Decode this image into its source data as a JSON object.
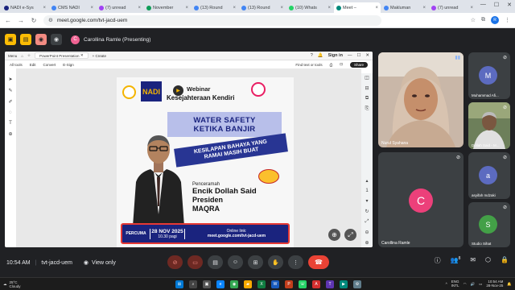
{
  "browser": {
    "tabs": [
      {
        "label": "NADI e-Sys",
        "icon": "nadi-icon",
        "color": "#1a237e"
      },
      {
        "label": "CMS NADI",
        "icon": "cms-icon",
        "color": "#4285f4"
      },
      {
        "label": "(7) unread",
        "icon": "mail-icon",
        "color": "#a142f4"
      },
      {
        "label": "November",
        "icon": "sheet-icon",
        "color": "#0f9d58"
      },
      {
        "label": "(13) Round",
        "icon": "chat-icon",
        "color": "#4285f4"
      },
      {
        "label": "(13) Round",
        "icon": "chat-icon",
        "color": "#4285f4"
      },
      {
        "label": "(10) Whats",
        "icon": "whatsapp-icon",
        "color": "#25d366"
      },
      {
        "label": "Meet –",
        "icon": "meet-icon",
        "color": "#00897b"
      },
      {
        "label": "Makluman",
        "icon": "doc-icon",
        "color": "#4285f4"
      },
      {
        "label": "(7) unread",
        "icon": "mail-icon",
        "color": "#a142f4"
      }
    ],
    "url": "meet.google.com/tvt-jacd-uem"
  },
  "presenting": {
    "name": "Carollina Ramle (Presenting)",
    "avatar_letter": "C"
  },
  "pdf": {
    "tab_title": "PowerPoint Presentation",
    "menu_label": "Menu",
    "create_label": "Create",
    "sign_in": "Sign in",
    "menus": [
      "All tools",
      "Edit",
      "Convert",
      "E-Sign"
    ],
    "search_tools": "Find text or tools",
    "share": "Share"
  },
  "poster": {
    "webinar": "Webinar",
    "subtitle": "Kesejahteraan Kendiri",
    "line1": "WATER SAFETY",
    "line2": "KETIKA BANJIR",
    "line3": "KESILAPAN BAHAYA YANG",
    "line4": "RAMAI MASIH BUAT",
    "penceramah": "Penceramah",
    "speaker": "Encik Dollah Said",
    "role": "Presiden",
    "org": "MAQRA",
    "percuma": "PERCUMA",
    "date": "28 NOV 2025",
    "time": "10.30 pagi",
    "online_label": "Online link:",
    "online_link": "meet.google.com/tvt-jacd-uem",
    "logo_text": "NADI"
  },
  "participants": {
    "main": {
      "name": "Nurul Syahana"
    },
    "carollina": {
      "name": "Carollina Ramle",
      "letter": "C",
      "color": "#ec407a"
    },
    "tiles": [
      {
        "name": "Muhammad Afi...",
        "letter": "M",
        "color": "#5c6bc0"
      },
      {
        "name": "Dollah Said - M...",
        "letter": "",
        "color": "#3c4043"
      },
      {
        "name": "asyifah mdzaki",
        "letter": "a",
        "color": "#5c6bc0"
      },
      {
        "name": "Studio Sihat",
        "letter": "S",
        "color": "#43a047"
      }
    ]
  },
  "meet": {
    "time": "10:54 AM",
    "separator": "|",
    "code": "tvt-jacd-uem",
    "view_only": "View only",
    "people_count": "8"
  },
  "taskbar": {
    "temp": "25°C",
    "weather": "Cloudy",
    "lang1": "ENG",
    "lang2": "INTL",
    "clock": "10:54 AM",
    "date": "28-Nov-25"
  }
}
